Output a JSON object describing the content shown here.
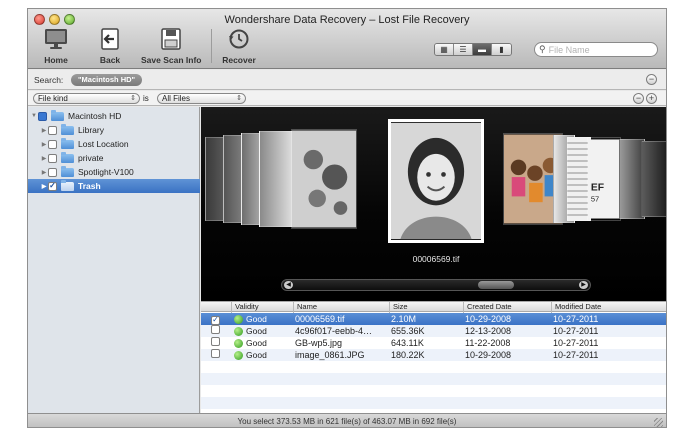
{
  "window": {
    "title": "Wondershare Data Recovery – Lost File Recovery"
  },
  "toolbar": {
    "buttons": [
      {
        "label": "Home",
        "icon": "monitor-icon"
      },
      {
        "label": "Back",
        "icon": "back-arrow-icon"
      },
      {
        "label": "Save Scan Info",
        "icon": "floppy-disk-icon"
      },
      {
        "label": "Recover",
        "icon": "history-clock-icon"
      }
    ],
    "view_modes": [
      "icon-view",
      "list-view",
      "column-view",
      "coverflow-view"
    ],
    "active_view": "column-view",
    "search_placeholder": "File Name"
  },
  "search_bar": {
    "label": "Search:",
    "scope": "\"Macintosh HD\""
  },
  "filter": {
    "kind": "File kind",
    "is_label": "is",
    "value": "All Files"
  },
  "sidebar": {
    "root": "Macintosh HD",
    "items": [
      {
        "label": "Library",
        "checked": false
      },
      {
        "label": "Lost Location",
        "checked": false
      },
      {
        "label": "private",
        "checked": false
      },
      {
        "label": "Spotlight-V100",
        "checked": false
      },
      {
        "label": "Trash",
        "checked": true,
        "selected": true
      }
    ]
  },
  "coverflow": {
    "current_file": "00006569.tif"
  },
  "table": {
    "columns": [
      "Validity",
      "Name",
      "Size",
      "Created Date",
      "Modified Date"
    ],
    "rows": [
      {
        "checked": true,
        "validity": "Good",
        "name": "00006569.tif",
        "size": "2.10M",
        "created": "10-29-2008",
        "modified": "10-27-2011",
        "selected": true
      },
      {
        "checked": false,
        "validity": "Good",
        "name": "4c96f017-eebb-4…",
        "size": "655.36K",
        "created": "12-13-2008",
        "modified": "10-27-2011"
      },
      {
        "checked": false,
        "validity": "Good",
        "name": "GB-wp5.jpg",
        "size": "643.11K",
        "created": "11-22-2008",
        "modified": "10-27-2011"
      },
      {
        "checked": false,
        "validity": "Good",
        "name": "image_0861.JPG",
        "size": "180.22K",
        "created": "10-29-2008",
        "modified": "10-27-2011"
      }
    ]
  },
  "status": {
    "text": "You select 373.53 MB in 621 file(s) of 463.07 MB in 692 file(s)"
  },
  "colors": {
    "selection": "#3a72c6",
    "good": "#2f9a1f",
    "sidebar": "#dfe4ea"
  }
}
